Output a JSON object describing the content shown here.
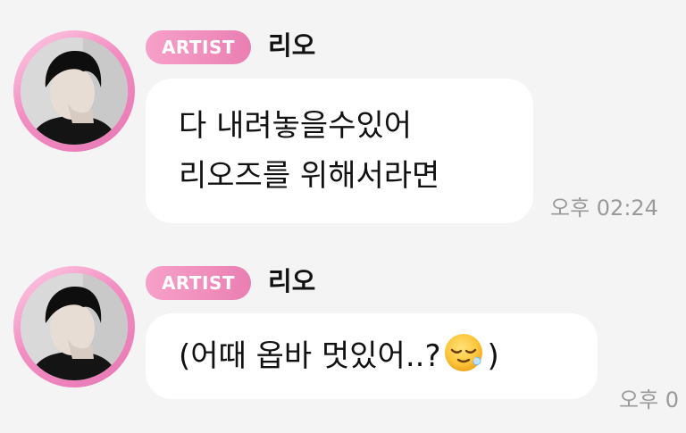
{
  "messages": [
    {
      "badge": "ARTIST",
      "sender": "리오",
      "lines": [
        "다 내려놓을수있어",
        "리오즈를 위해서라면"
      ],
      "time": "오후 02:24"
    },
    {
      "badge": "ARTIST",
      "sender": "리오",
      "text_before_emoji": "(어때 옵바 멋있어..?",
      "emoji": "relieved-face-emoji",
      "text_after_emoji": ")",
      "time": "오후 0"
    }
  ],
  "colors": {
    "background": "#f4f4f4",
    "bubble": "#ffffff",
    "badge": "#f08fbd",
    "avatar_ring": "#f28ec2",
    "timestamp": "#9a9a9a"
  }
}
